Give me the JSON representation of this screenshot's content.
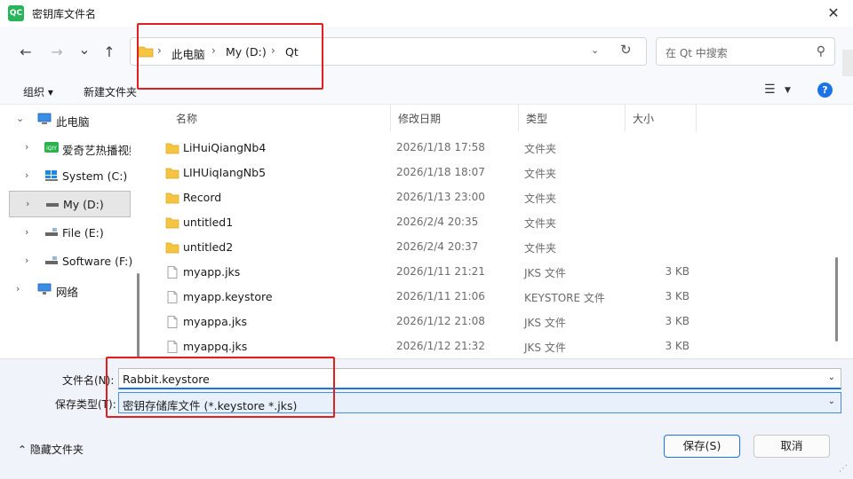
{
  "window": {
    "app_icon_text": "QC",
    "title": "密钥库文件名",
    "close_glyph": "✕"
  },
  "nav": {
    "back_glyph": "←",
    "forward_glyph": "→",
    "recent_glyph": "⌄",
    "up_glyph": "↑",
    "breadcrumbs": [
      "此电脑",
      "My (D:)",
      "Qt"
    ],
    "separator": "›",
    "dropdown_glyph": "⌄",
    "refresh_glyph": "↻",
    "search_placeholder": "在 Qt 中搜索",
    "search_glyph": "⚲"
  },
  "toolbar": {
    "organize": "组织 ▾",
    "new_folder": "新建文件夹",
    "view_glyph": "☰",
    "view_caret": "▼",
    "help_glyph": "?"
  },
  "sidebar": {
    "items": [
      {
        "arrow": "⌄",
        "label": "此电脑",
        "icon": "pc-icon"
      },
      {
        "arrow": "›",
        "label": "爱奇艺热播视频",
        "icon": "iqiyi-icon"
      },
      {
        "arrow": "›",
        "label": "System (C:)",
        "icon": "drive-icon"
      },
      {
        "arrow": "›",
        "label": "My (D:)",
        "icon": "drive-icon"
      },
      {
        "arrow": "›",
        "label": "File (E:)",
        "icon": "drive-icon"
      },
      {
        "arrow": "›",
        "label": "Software (F:)",
        "icon": "drive-icon"
      },
      {
        "arrow": "›",
        "label": "网络",
        "icon": "network-icon"
      }
    ],
    "selected_index": 3
  },
  "filelist": {
    "headers": {
      "name": "名称",
      "date": "修改日期",
      "type": "类型",
      "size": "大小"
    },
    "sort_glyph": "^",
    "rows": [
      {
        "name": "LiHuiQiangNb4",
        "date": "2026/1/18 17:58",
        "type": "文件夹",
        "size": "",
        "icon": "folder-icon"
      },
      {
        "name": "LIHUiqIangNb5",
        "date": "2026/1/18 18:07",
        "type": "文件夹",
        "size": "",
        "icon": "folder-icon"
      },
      {
        "name": "Record",
        "date": "2026/1/13 23:00",
        "type": "文件夹",
        "size": "",
        "icon": "folder-icon"
      },
      {
        "name": "untitled1",
        "date": "2026/2/4 20:35",
        "type": "文件夹",
        "size": "",
        "icon": "folder-icon"
      },
      {
        "name": "untitled2",
        "date": "2026/2/4 20:37",
        "type": "文件夹",
        "size": "",
        "icon": "folder-icon"
      },
      {
        "name": "myapp.jks",
        "date": "2026/1/11 21:21",
        "type": "JKS 文件",
        "size": "3 KB",
        "icon": "file-icon"
      },
      {
        "name": "myapp.keystore",
        "date": "2026/1/11 21:06",
        "type": "KEYSTORE 文件",
        "size": "3 KB",
        "icon": "file-icon"
      },
      {
        "name": "myappa.jks",
        "date": "2026/1/12 21:08",
        "type": "JKS 文件",
        "size": "3 KB",
        "icon": "file-icon"
      },
      {
        "name": "myappq.jks",
        "date": "2026/1/12 21:32",
        "type": "JKS 文件",
        "size": "3 KB",
        "icon": "file-icon"
      }
    ]
  },
  "form": {
    "filename_label": "文件名(N):",
    "filename_value": "Rabbit.keystore",
    "filetype_label": "保存类型(T):",
    "filetype_value": "密钥存储库文件 (*.keystore *.jks)",
    "caret_glyph": "⌄"
  },
  "footer": {
    "hide_folders": "⌃  隐藏文件夹",
    "save": "保存(S)",
    "cancel": "取消",
    "grip_glyph": "⋰"
  },
  "colors": {
    "accent": "#1a73e8",
    "highlight": "#e02020",
    "folder": "#f5c542",
    "app_icon": "#27b45b"
  }
}
